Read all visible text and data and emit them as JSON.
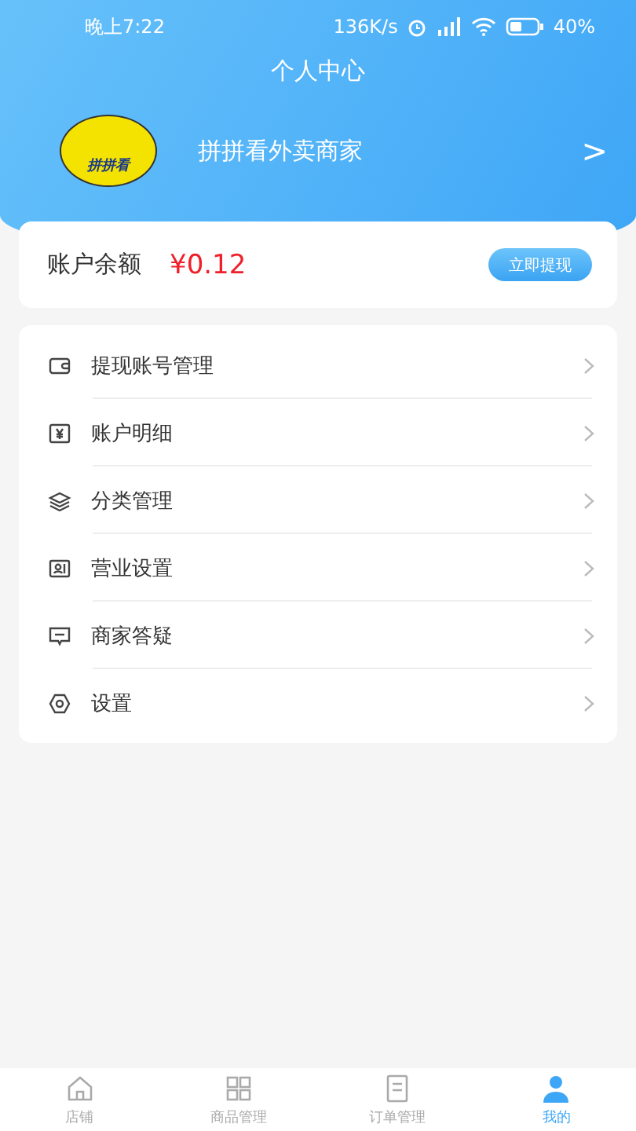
{
  "status_bar": {
    "time": "晚上7:22",
    "speed": "136K/s",
    "battery": "40%"
  },
  "header": {
    "title": "个人中心",
    "merchant_name": "拼拼看外卖商家",
    "logo_text": "拼拼看",
    "chevron": ">"
  },
  "balance": {
    "label": "账户余额",
    "amount": "¥0.12",
    "button": "立即提现"
  },
  "menu": [
    {
      "label": "提现账号管理"
    },
    {
      "label": "账户明细"
    },
    {
      "label": "分类管理"
    },
    {
      "label": "营业设置"
    },
    {
      "label": "商家答疑"
    },
    {
      "label": "设置"
    }
  ],
  "tabs": [
    {
      "label": "店铺",
      "selected": false
    },
    {
      "label": "商品管理",
      "selected": false
    },
    {
      "label": "订单管理",
      "selected": false
    },
    {
      "label": "我的",
      "selected": true
    }
  ]
}
